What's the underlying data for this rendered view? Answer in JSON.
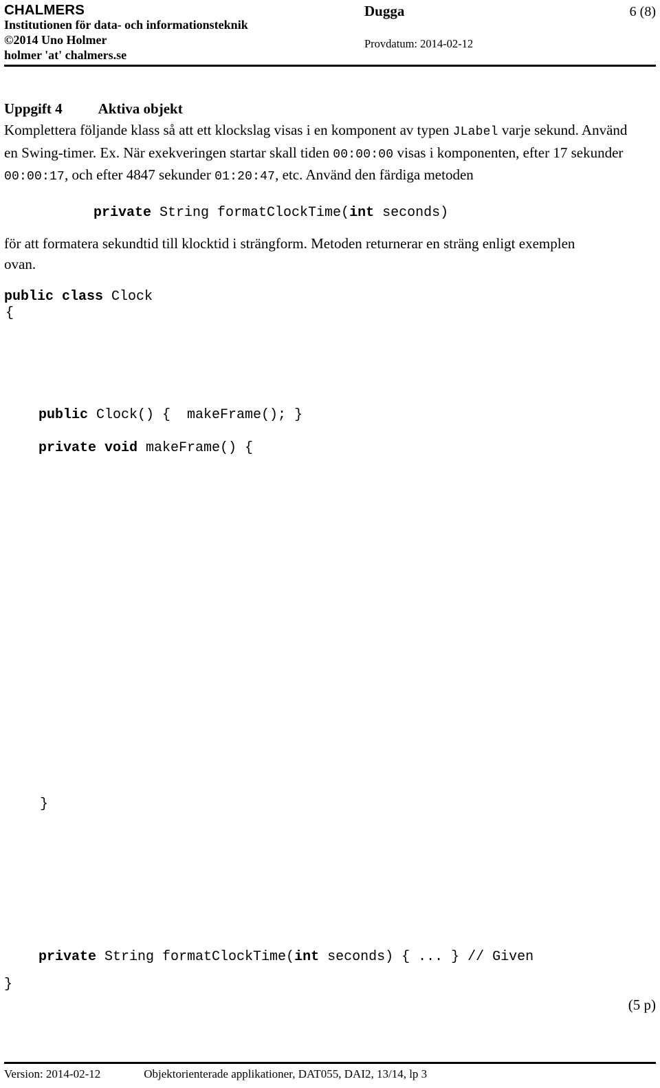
{
  "header": {
    "institution": "CHALMERS",
    "department": "Institutionen för data- och informationsteknik",
    "copyright": "©2014 Uno Holmer",
    "email": "holmer 'at' chalmers.se",
    "doc_title": "Dugga",
    "page_number": "6 (8)",
    "exam_date_label": "Provdatum: 2014-02-12"
  },
  "task": {
    "number_label": "Uppgift 4",
    "title": "Aktiva objekt",
    "paragraph1": {
      "t1": "Komplettera följande klass så att ett klockslag visas i en komponent av typen ",
      "c1": "JLabel",
      "t2": " varje sekund. Använd en Swing-timer. Ex. När exekveringen startar skall tiden ",
      "c2": "00:00:00",
      "t3": " visas i komponenten, efter 17 sekunder ",
      "c3": "00:00:17",
      "t4": ", och efter 4847 sekunder ",
      "c4": "01:20:47",
      "t5": ", etc. Använd den färdiga metoden"
    },
    "signature": {
      "kw1": "private",
      "mid": " String formatClockTime(",
      "kw2": "int",
      "tail": " seconds)"
    },
    "paragraph2": "för att formatera sekundtid till klocktid i strängform. Metoden returnerar en sträng enligt exemplen ovan.",
    "points": "(5 p)"
  },
  "code": {
    "class_decl_kw": "public class",
    "class_decl_name": " Clock",
    "open_brace": "{",
    "ctor_kw": "public",
    "ctor_rest": " Clock() {  makeFrame(); }",
    "makeframe_kw": "private void",
    "makeframe_rest": " makeFrame() {",
    "inner_close_brace": "}",
    "fmt_kw1": "private",
    "fmt_mid": " String formatClockTime(",
    "fmt_kw2": "int",
    "fmt_tail": " seconds) { ... } // Given",
    "outer_close_brace": "}"
  },
  "footer": {
    "version": "Version: 2014-02-12",
    "course": "Objektorienterade applikationer, DAT055, DAI2, 13/14, lp 3"
  },
  "colors": {
    "text": "#000000",
    "background": "#ffffff",
    "rule": "#000000"
  }
}
